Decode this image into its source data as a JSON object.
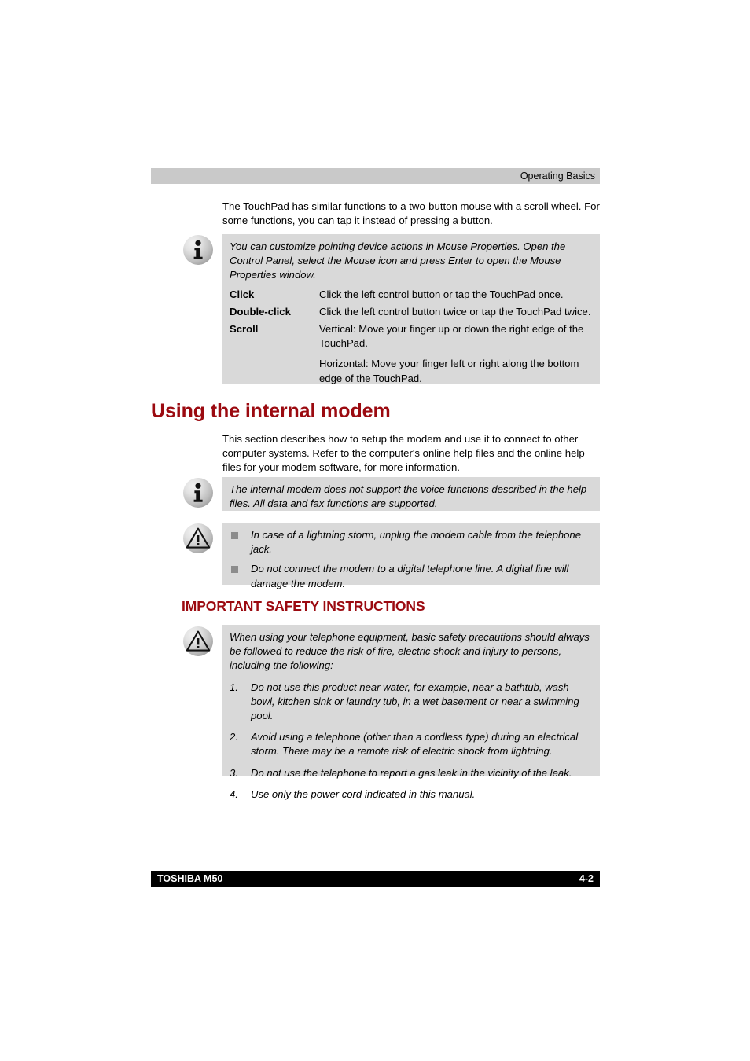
{
  "page": {
    "header_text": "Operating Basics",
    "footer_left": "TOSHIBA M50",
    "footer_right": "4-2"
  },
  "colors": {
    "heading_red": "#9b0a10",
    "callout_gray": "#D9D9D9",
    "header_gray": "#C9C9C9",
    "footer_black": "#000000",
    "bullet_gray": "#8C8C8C"
  },
  "content": {
    "intro_paragraph": "The TouchPad has similar functions to a two-button mouse with a scroll wheel. For some functions, you can tap it instead of pressing a button.",
    "touchpad_note": {
      "icon": "info-icon",
      "text": "You can customize pointing device actions in Mouse Properties. Open the Control Panel, select the Mouse icon and press Enter to open the Mouse Properties window.",
      "definitions": [
        {
          "term": "Click",
          "description": "Click the left control button or tap the TouchPad once.",
          "description_extra": ""
        },
        {
          "term": "Double-click",
          "description": "Click the left control button twice or tap the TouchPad twice.",
          "description_extra": ""
        },
        {
          "term": "Scroll",
          "description": "Vertical: Move your finger up or down the right edge of the TouchPad.",
          "description_extra": "Horizontal: Move your finger left or right along the bottom edge of the TouchPad."
        }
      ]
    },
    "modem_section": {
      "heading": "Using the internal modem",
      "paragraph": "This section describes how to setup the modem and use it to connect to other computer systems. Refer to the computer's online help files and the online help files for your modem software, for more information.",
      "note": {
        "icon": "info-icon",
        "text": "The internal modem does not support the voice functions described in the help files. All data and fax functions are supported."
      },
      "caution": {
        "icon": "warning-icon",
        "bullets": [
          "In case of a lightning storm, unplug the modem cable from the telephone jack.",
          "Do not connect the modem to a digital telephone line. A digital line will damage the modem."
        ]
      }
    },
    "safety_section": {
      "heading": "IMPORTANT SAFETY INSTRUCTIONS",
      "warning": {
        "icon": "warning-icon",
        "intro": "When using your telephone equipment, basic safety precautions should always be followed to reduce the risk of fire, electric shock and injury to persons, including the following:",
        "items": [
          {
            "number": "1.",
            "text": "Do not use this product near water, for example, near a bathtub, wash bowl, kitchen sink or laundry tub, in a wet basement or near a swimming pool."
          },
          {
            "number": "2.",
            "text": "Avoid using a telephone (other than a cordless type) during an electrical storm. There may be a remote risk of electric shock from lightning."
          },
          {
            "number": "3.",
            "text": "Do not use the telephone to report a gas leak in the vicinity of the leak."
          },
          {
            "number": "4.",
            "text": "Use only the power cord indicated in this manual."
          }
        ]
      }
    }
  }
}
